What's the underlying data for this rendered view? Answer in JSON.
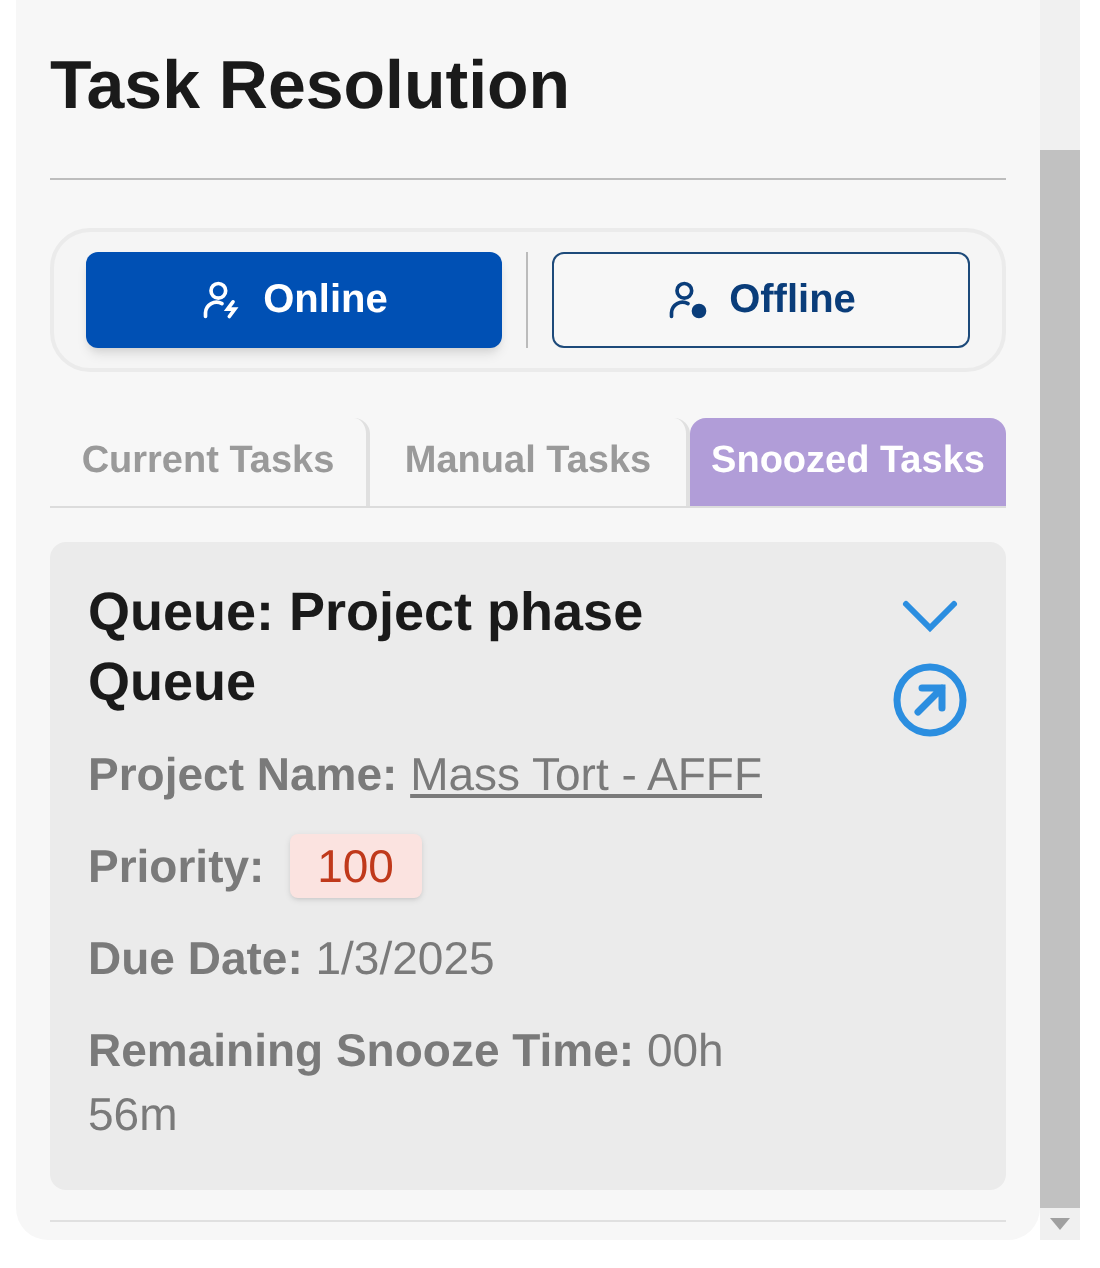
{
  "title": "Task Resolution",
  "status_buttons": [
    {
      "label": "Online",
      "kind": "online",
      "selected": true
    },
    {
      "label": "Offline",
      "kind": "offline",
      "selected": false
    }
  ],
  "tabs": [
    {
      "label": "Current Tasks",
      "selected": false
    },
    {
      "label": "Manual Tasks",
      "selected": false
    },
    {
      "label": "Snoozed Tasks",
      "selected": true
    }
  ],
  "task_card": {
    "title": "Queue: Project phase Queue",
    "fields": [
      {
        "label": "Project Name:",
        "value": "Mass Tort - AFFF",
        "kind": "link"
      },
      {
        "label": "Priority:",
        "value": "100",
        "kind": "badge"
      },
      {
        "label": "Due Date:",
        "value": "1/3/2025",
        "kind": "text"
      },
      {
        "label": "Remaining Snooze Time:",
        "value": "00h 56m",
        "kind": "text"
      }
    ]
  }
}
